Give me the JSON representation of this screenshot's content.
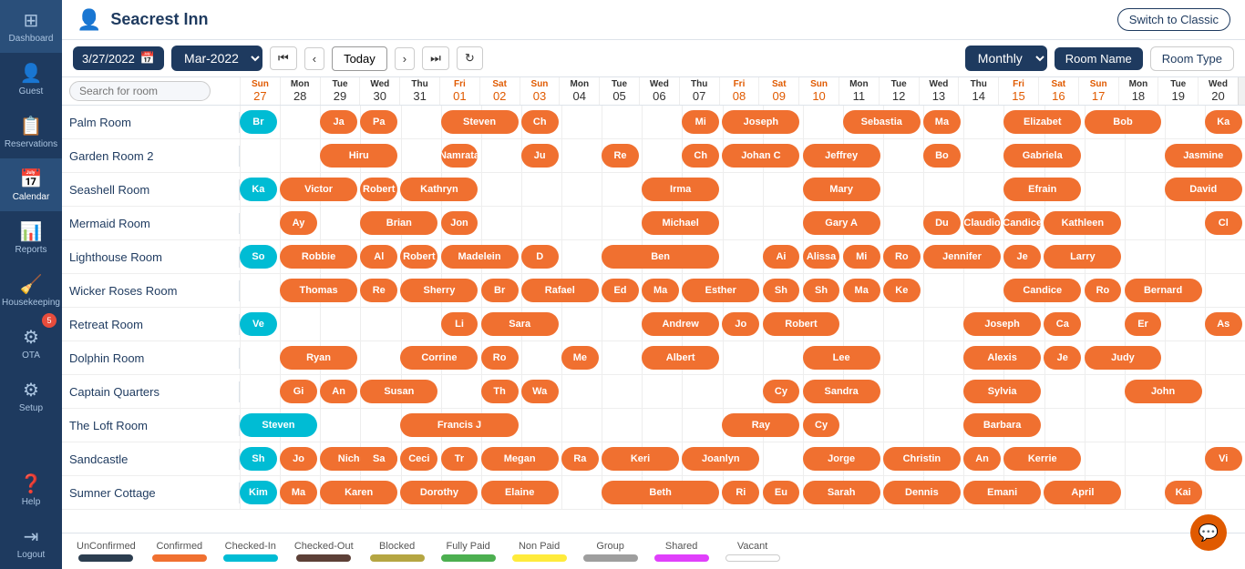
{
  "app": {
    "title": "Seacrest Inn",
    "switch_classic": "Switch to Classic"
  },
  "sidebar": {
    "items": [
      {
        "label": "Dashboard",
        "icon": "⊞"
      },
      {
        "label": "Guest",
        "icon": "👤"
      },
      {
        "label": "Reservations",
        "icon": "📋"
      },
      {
        "label": "Calendar",
        "icon": "📅",
        "active": true
      },
      {
        "label": "Reports",
        "icon": "📊"
      },
      {
        "label": "Housekeeping",
        "icon": "🧹"
      },
      {
        "label": "OTA",
        "icon": "⚙",
        "badge": "5"
      },
      {
        "label": "Setup",
        "icon": "⚙"
      },
      {
        "label": "Help",
        "icon": "?"
      },
      {
        "label": "Logout",
        "icon": "⇥"
      }
    ]
  },
  "toolbar": {
    "date": "3/27/2022",
    "month": "Mar-2022",
    "today_label": "Today",
    "view": "Monthly",
    "room_name_label": "Room Name",
    "room_type_label": "Room Type",
    "search_placeholder": "Search for room"
  },
  "day_headers": [
    {
      "dow": "Sun",
      "dom": "27",
      "weekend": true
    },
    {
      "dow": "Mon",
      "dom": "28",
      "weekend": false
    },
    {
      "dow": "Tue",
      "dom": "29",
      "weekend": false
    },
    {
      "dow": "Wed",
      "dom": "30",
      "weekend": false
    },
    {
      "dow": "Thu",
      "dom": "31",
      "weekend": false
    },
    {
      "dow": "Fri",
      "dom": "01",
      "weekend": true
    },
    {
      "dow": "Sat",
      "dom": "02",
      "weekend": true
    },
    {
      "dow": "Sun",
      "dom": "03",
      "weekend": true
    },
    {
      "dow": "Mon",
      "dom": "04",
      "weekend": false
    },
    {
      "dow": "Tue",
      "dom": "05",
      "weekend": false
    },
    {
      "dow": "Wed",
      "dom": "06",
      "weekend": false
    },
    {
      "dow": "Thu",
      "dom": "07",
      "weekend": false
    },
    {
      "dow": "Fri",
      "dom": "08",
      "weekend": true
    },
    {
      "dow": "Sat",
      "dom": "09",
      "weekend": true
    },
    {
      "dow": "Sun",
      "dom": "10",
      "weekend": true
    },
    {
      "dow": "Mon",
      "dom": "11",
      "weekend": false
    },
    {
      "dow": "Tue",
      "dom": "12",
      "weekend": false
    },
    {
      "dow": "Wed",
      "dom": "13",
      "weekend": false
    },
    {
      "dow": "Thu",
      "dom": "14",
      "weekend": false
    },
    {
      "dow": "Fri",
      "dom": "15",
      "weekend": true
    },
    {
      "dow": "Sat",
      "dom": "16",
      "weekend": true
    },
    {
      "dow": "Sun",
      "dom": "17",
      "weekend": true
    },
    {
      "dow": "Mon",
      "dom": "18",
      "weekend": false
    },
    {
      "dow": "Tue",
      "dom": "19",
      "weekend": false
    },
    {
      "dow": "Wed",
      "dom": "20",
      "weekend": false
    }
  ],
  "rooms": [
    {
      "name": "Palm Room",
      "bookings": [
        {
          "text": "Br",
          "start": 0,
          "span": 1,
          "color": "cyan"
        },
        {
          "text": "Ja",
          "start": 2,
          "span": 1
        },
        {
          "text": "Pa",
          "start": 3,
          "span": 1
        },
        {
          "text": "Steven",
          "start": 5,
          "span": 2
        },
        {
          "text": "Ch",
          "start": 7,
          "span": 1
        },
        {
          "text": "Mi",
          "start": 11,
          "span": 1
        },
        {
          "text": "Joseph",
          "start": 12,
          "span": 2
        },
        {
          "text": "Sebastia",
          "start": 15,
          "span": 2
        },
        {
          "text": "Ma",
          "start": 17,
          "span": 1
        },
        {
          "text": "Elizabet",
          "start": 19,
          "span": 2
        },
        {
          "text": "Bob",
          "start": 21,
          "span": 2
        },
        {
          "text": "Ka",
          "start": 24,
          "span": 1
        }
      ]
    },
    {
      "name": "Garden Room 2",
      "bookings": [
        {
          "text": "Hiru",
          "start": 2,
          "span": 2
        },
        {
          "text": "Namrata",
          "start": 5,
          "span": 1
        },
        {
          "text": "Ju",
          "start": 7,
          "span": 1
        },
        {
          "text": "Re",
          "start": 9,
          "span": 1
        },
        {
          "text": "Ch",
          "start": 11,
          "span": 1
        },
        {
          "text": "Johan C",
          "start": 12,
          "span": 2
        },
        {
          "text": "Jeffrey",
          "start": 14,
          "span": 2
        },
        {
          "text": "Bo",
          "start": 17,
          "span": 1
        },
        {
          "text": "Gabriela",
          "start": 19,
          "span": 2
        },
        {
          "text": "Jasmine",
          "start": 23,
          "span": 2
        }
      ]
    },
    {
      "name": "Seashell Room",
      "bookings": [
        {
          "text": "Ka",
          "start": 0,
          "span": 1,
          "color": "cyan"
        },
        {
          "text": "Victor",
          "start": 1,
          "span": 2
        },
        {
          "text": "Robert",
          "start": 3,
          "span": 1
        },
        {
          "text": "Kathryn",
          "start": 4,
          "span": 2
        },
        {
          "text": "Irma",
          "start": 10,
          "span": 2
        },
        {
          "text": "Mary",
          "start": 14,
          "span": 2
        },
        {
          "text": "Efrain",
          "start": 19,
          "span": 2
        },
        {
          "text": "David",
          "start": 23,
          "span": 2
        }
      ]
    },
    {
      "name": "Mermaid Room",
      "bookings": [
        {
          "text": "Ay",
          "start": 1,
          "span": 1
        },
        {
          "text": "Brian",
          "start": 3,
          "span": 2
        },
        {
          "text": "Jon",
          "start": 5,
          "span": 1
        },
        {
          "text": "Michael",
          "start": 10,
          "span": 2
        },
        {
          "text": "Gary A",
          "start": 14,
          "span": 2
        },
        {
          "text": "Du",
          "start": 17,
          "span": 1
        },
        {
          "text": "Claudio",
          "start": 18,
          "span": 1
        },
        {
          "text": "Candice",
          "start": 19,
          "span": 1
        },
        {
          "text": "Kathleen",
          "start": 20,
          "span": 2
        },
        {
          "text": "Cl",
          "start": 24,
          "span": 1
        }
      ]
    },
    {
      "name": "Lighthouse Room",
      "bookings": [
        {
          "text": "So",
          "start": 0,
          "span": 1,
          "color": "cyan"
        },
        {
          "text": "Robbie",
          "start": 1,
          "span": 2
        },
        {
          "text": "Al",
          "start": 3,
          "span": 1
        },
        {
          "text": "Robert",
          "start": 4,
          "span": 1
        },
        {
          "text": "Madelein",
          "start": 5,
          "span": 2
        },
        {
          "text": "D",
          "start": 7,
          "span": 1
        },
        {
          "text": "Ben",
          "start": 9,
          "span": 3
        },
        {
          "text": "Ai",
          "start": 13,
          "span": 1
        },
        {
          "text": "Alissa",
          "start": 14,
          "span": 1
        },
        {
          "text": "Mi",
          "start": 15,
          "span": 1
        },
        {
          "text": "Ro",
          "start": 16,
          "span": 1
        },
        {
          "text": "Jennifer",
          "start": 17,
          "span": 2
        },
        {
          "text": "Je",
          "start": 19,
          "span": 1
        },
        {
          "text": "Larry",
          "start": 20,
          "span": 2
        }
      ]
    },
    {
      "name": "Wicker Roses Room",
      "bookings": [
        {
          "text": "Thomas",
          "start": 1,
          "span": 2
        },
        {
          "text": "Re",
          "start": 3,
          "span": 1
        },
        {
          "text": "Sherry",
          "start": 4,
          "span": 2
        },
        {
          "text": "Br",
          "start": 6,
          "span": 1
        },
        {
          "text": "Rafael",
          "start": 7,
          "span": 2
        },
        {
          "text": "Ed",
          "start": 9,
          "span": 1
        },
        {
          "text": "Ma",
          "start": 10,
          "span": 1
        },
        {
          "text": "Esther",
          "start": 11,
          "span": 2
        },
        {
          "text": "Sh",
          "start": 13,
          "span": 1
        },
        {
          "text": "Sh",
          "start": 14,
          "span": 1
        },
        {
          "text": "Ma",
          "start": 15,
          "span": 1
        },
        {
          "text": "Ke",
          "start": 16,
          "span": 1
        },
        {
          "text": "Candice",
          "start": 19,
          "span": 2
        },
        {
          "text": "Ro",
          "start": 21,
          "span": 1
        },
        {
          "text": "Bernard",
          "start": 22,
          "span": 2
        }
      ]
    },
    {
      "name": "Retreat Room",
      "bookings": [
        {
          "text": "Ve",
          "start": 0,
          "span": 1,
          "color": "cyan"
        },
        {
          "text": "Li",
          "start": 5,
          "span": 1
        },
        {
          "text": "Sara",
          "start": 6,
          "span": 2
        },
        {
          "text": "Andrew",
          "start": 10,
          "span": 2
        },
        {
          "text": "Jo",
          "start": 12,
          "span": 1
        },
        {
          "text": "Robert",
          "start": 13,
          "span": 2
        },
        {
          "text": "Joseph",
          "start": 18,
          "span": 2
        },
        {
          "text": "Ca",
          "start": 20,
          "span": 1
        },
        {
          "text": "Er",
          "start": 22,
          "span": 1
        },
        {
          "text": "As",
          "start": 24,
          "span": 1
        }
      ]
    },
    {
      "name": "Dolphin Room",
      "bookings": [
        {
          "text": "Ryan",
          "start": 1,
          "span": 2
        },
        {
          "text": "Corrine",
          "start": 4,
          "span": 2
        },
        {
          "text": "Ro",
          "start": 6,
          "span": 1
        },
        {
          "text": "Me",
          "start": 8,
          "span": 1
        },
        {
          "text": "Albert",
          "start": 10,
          "span": 2
        },
        {
          "text": "Lee",
          "start": 14,
          "span": 2
        },
        {
          "text": "Alexis",
          "start": 18,
          "span": 2
        },
        {
          "text": "Je",
          "start": 20,
          "span": 1
        },
        {
          "text": "Judy",
          "start": 21,
          "span": 2
        }
      ]
    },
    {
      "name": "Captain Quarters",
      "bookings": [
        {
          "text": "Gi",
          "start": 1,
          "span": 1
        },
        {
          "text": "An",
          "start": 2,
          "span": 1
        },
        {
          "text": "Susan",
          "start": 3,
          "span": 2
        },
        {
          "text": "Th",
          "start": 6,
          "span": 1
        },
        {
          "text": "Wa",
          "start": 7,
          "span": 1
        },
        {
          "text": "Cy",
          "start": 13,
          "span": 1
        },
        {
          "text": "Sandra",
          "start": 14,
          "span": 2
        },
        {
          "text": "Sylvia",
          "start": 18,
          "span": 2
        },
        {
          "text": "John",
          "start": 22,
          "span": 2
        }
      ]
    },
    {
      "name": "The Loft Room",
      "bookings": [
        {
          "text": "Steven",
          "start": 0,
          "span": 2,
          "color": "cyan"
        },
        {
          "text": "Francis J",
          "start": 4,
          "span": 3
        },
        {
          "text": "Ray",
          "start": 12,
          "span": 2
        },
        {
          "text": "Cy",
          "start": 14,
          "span": 1
        },
        {
          "text": "Barbara",
          "start": 18,
          "span": 2
        }
      ]
    },
    {
      "name": "Sandcastle",
      "bookings": [
        {
          "text": "Sh",
          "start": 0,
          "span": 1,
          "color": "cyan"
        },
        {
          "text": "Jo",
          "start": 1,
          "span": 1
        },
        {
          "text": "Nicholas",
          "start": 2,
          "span": 2
        },
        {
          "text": "Sa",
          "start": 3,
          "span": 1
        },
        {
          "text": "Ceci",
          "start": 4,
          "span": 1
        },
        {
          "text": "Tr",
          "start": 5,
          "span": 1
        },
        {
          "text": "Megan",
          "start": 6,
          "span": 2
        },
        {
          "text": "Ra",
          "start": 8,
          "span": 1
        },
        {
          "text": "Keri",
          "start": 9,
          "span": 2
        },
        {
          "text": "Joanlyn",
          "start": 11,
          "span": 2
        },
        {
          "text": "Jorge",
          "start": 14,
          "span": 2
        },
        {
          "text": "Christin",
          "start": 16,
          "span": 2
        },
        {
          "text": "An",
          "start": 18,
          "span": 1
        },
        {
          "text": "Kerrie",
          "start": 19,
          "span": 2
        },
        {
          "text": "Vi",
          "start": 24,
          "span": 1
        }
      ]
    },
    {
      "name": "Sumner Cottage",
      "bookings": [
        {
          "text": "Kim",
          "start": 0,
          "span": 1,
          "color": "cyan"
        },
        {
          "text": "Ma",
          "start": 1,
          "span": 1
        },
        {
          "text": "Karen",
          "start": 2,
          "span": 2
        },
        {
          "text": "Dorothy",
          "start": 4,
          "span": 2
        },
        {
          "text": "Elaine",
          "start": 6,
          "span": 2
        },
        {
          "text": "Beth",
          "start": 9,
          "span": 3
        },
        {
          "text": "Ri",
          "start": 12,
          "span": 1
        },
        {
          "text": "Eu",
          "start": 13,
          "span": 1
        },
        {
          "text": "Sarah",
          "start": 14,
          "span": 2
        },
        {
          "text": "Dennis",
          "start": 16,
          "span": 2
        },
        {
          "text": "Emani",
          "start": 18,
          "span": 2
        },
        {
          "text": "April",
          "start": 20,
          "span": 2
        },
        {
          "text": "Kai",
          "start": 23,
          "span": 1
        }
      ]
    }
  ],
  "legend": [
    {
      "label": "UnConfirmed",
      "color": "#2c3e50"
    },
    {
      "label": "Confirmed",
      "color": "#f07030"
    },
    {
      "label": "Checked-In",
      "color": "#00bcd4"
    },
    {
      "label": "Checked-Out",
      "color": "#5d4037"
    },
    {
      "label": "Blocked",
      "color": "#b5a642"
    },
    {
      "label": "Fully Paid",
      "color": "#4caf50"
    },
    {
      "label": "Non Paid",
      "color": "#ffeb3b"
    },
    {
      "label": "Group",
      "color": "#9e9e9e"
    },
    {
      "label": "Shared",
      "color": "#e040fb"
    },
    {
      "label": "Vacant",
      "color": "#ffffff"
    }
  ]
}
